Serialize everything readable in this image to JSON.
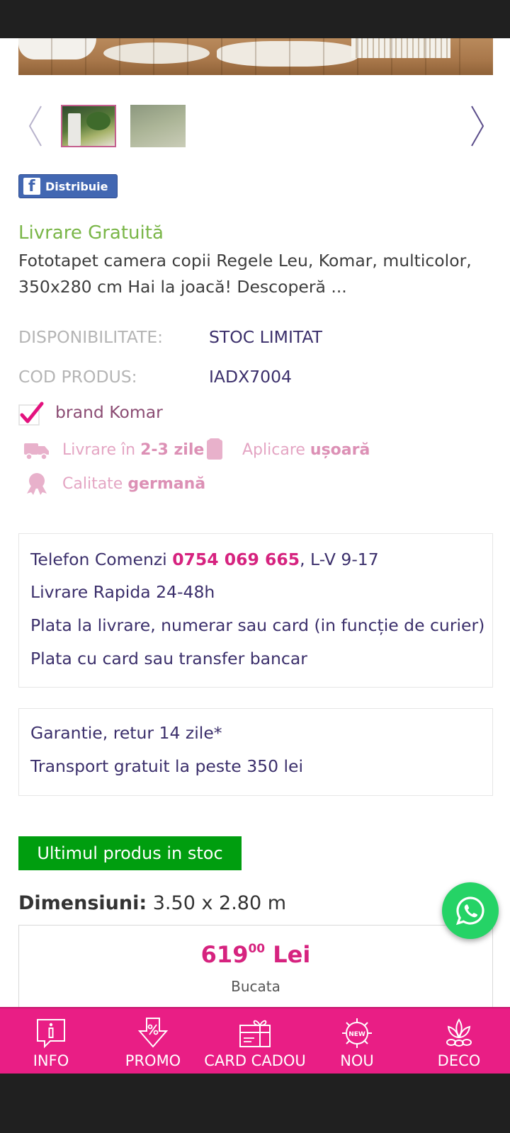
{
  "product": {
    "free_shipping_label": "Livrare Gratuită",
    "description": "Fototapet camera copii Regele Leu, Komar, multicolor, 350x280 cm Hai la joacă! Descoperă ...",
    "share_button_label": "Distribuie",
    "specs": {
      "availability_label": "DISPONIBILITATE:",
      "availability_value": "STOC LIMITAT",
      "code_label": "COD PRODUS:",
      "code_value": "IADX7004"
    },
    "brand_text": "brand Komar",
    "features": {
      "delivery_prefix": "Livrare în",
      "delivery_bold": "2-3 zile",
      "apply_prefix": "Aplicare",
      "apply_bold": "ușoară",
      "quality_prefix": "Calitate",
      "quality_bold": "germană"
    },
    "stock_badge": "Ultimul produs in stoc",
    "dimensions_label": "Dimensiuni:",
    "dimensions_value": "3.50 x 2.80 m",
    "price": {
      "integer": "619",
      "decimals": "00",
      "currency": "Lei",
      "unit": "Bucata"
    }
  },
  "info_box_1": {
    "phone_prefix": "Telefon Comenzi",
    "phone_number": "0754 069 665",
    "phone_suffix": ", L-V 9-17",
    "line_2": "Livrare Rapida 24-48h",
    "line_3": "Plata la livrare, numerar sau card (in funcție de curier)",
    "line_4": "Plata cu card sau transfer bancar"
  },
  "info_box_2": {
    "line_1": "Garantie, retur 14 zile*",
    "line_2": "Transport gratuit la peste 350 lei"
  },
  "bottom_nav": {
    "items": [
      {
        "label": "INFO",
        "icon": "info-icon"
      },
      {
        "label": "PROMO",
        "icon": "promo-icon"
      },
      {
        "label": "CARD CADOU",
        "icon": "gift-card-icon"
      },
      {
        "label": "NOU",
        "icon": "new-icon"
      },
      {
        "label": "DECO",
        "icon": "deco-icon"
      }
    ]
  },
  "colors": {
    "brand_pink": "#e91e85",
    "price_pink": "#d6237f",
    "green_free_shipping": "#7ab648",
    "stock_green": "#009e0f",
    "text_purple": "#3b2f6b",
    "whatsapp_green": "#25d366"
  }
}
